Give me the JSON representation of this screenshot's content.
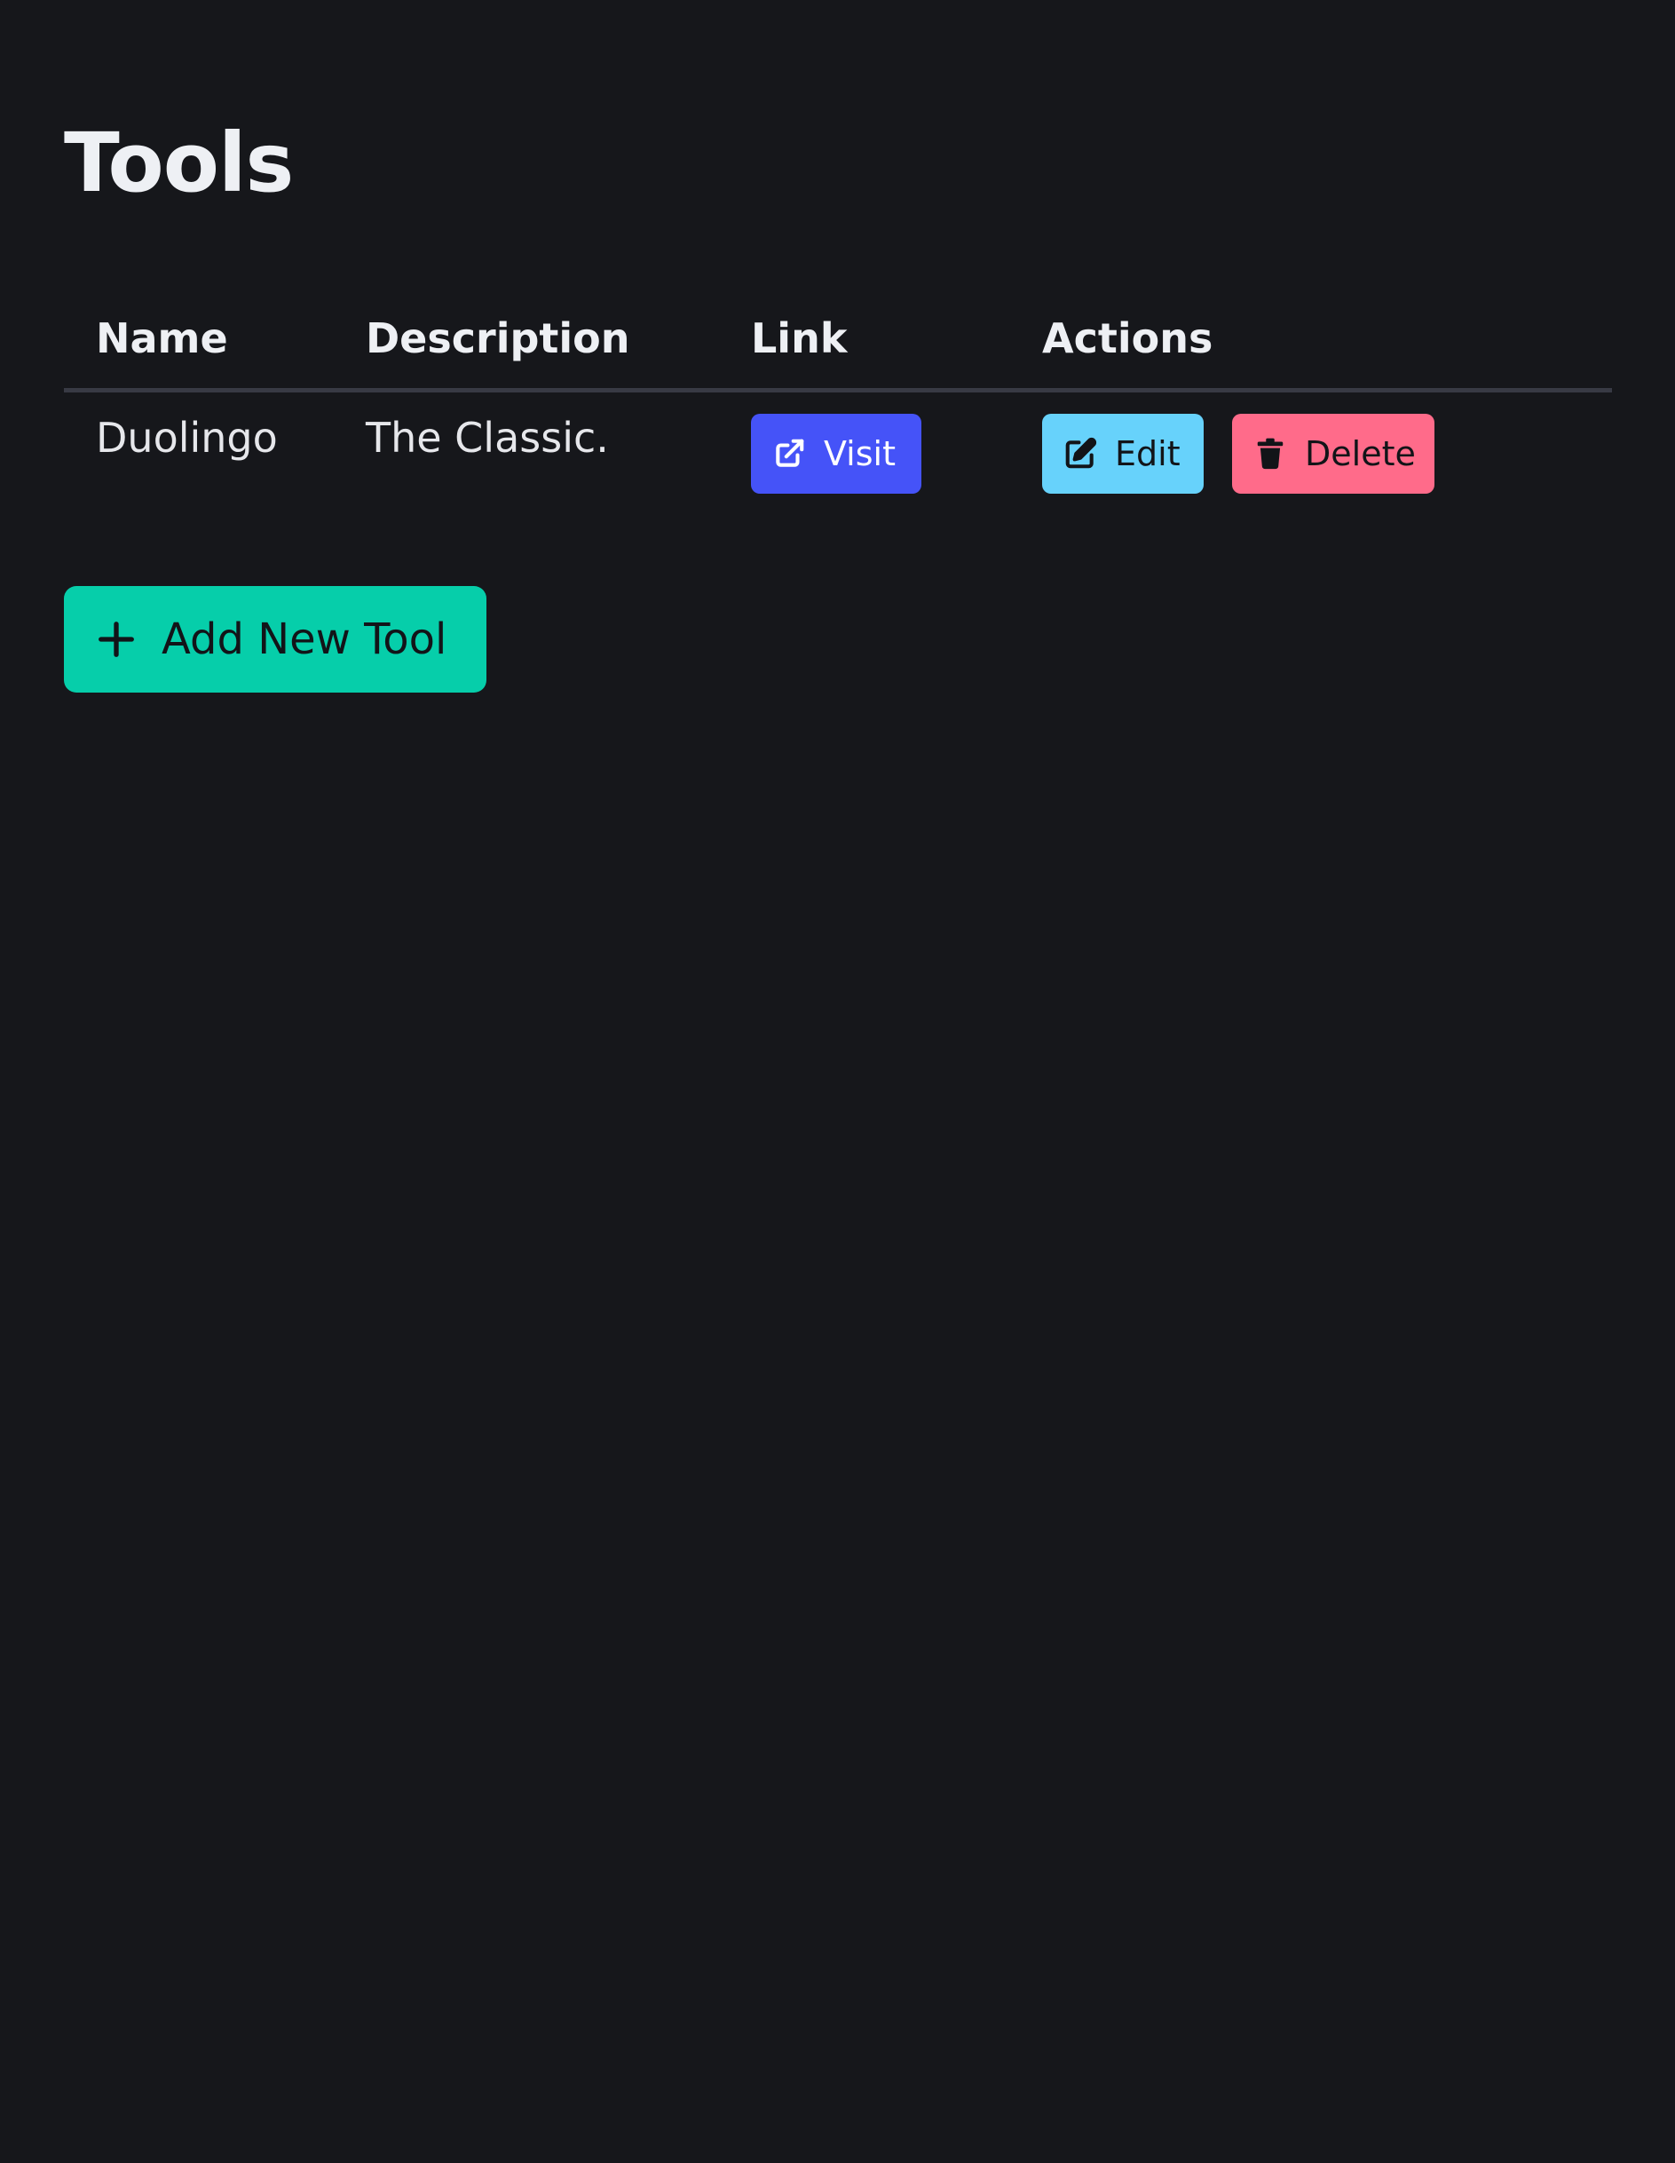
{
  "page": {
    "title": "Tools",
    "background": "#16171b"
  },
  "table": {
    "columns": [
      "Name",
      "Description",
      "Link",
      "Actions"
    ],
    "rows": [
      {
        "name": "Duolingo",
        "description": "The Classic.",
        "link_label": "Visit",
        "edit_label": "Edit",
        "delete_label": "Delete"
      }
    ]
  },
  "actions": {
    "add_label": "Add New Tool"
  },
  "icons": {
    "visit": "external-link-icon",
    "edit": "edit-icon",
    "delete": "trash-icon",
    "add": "plus-icon"
  },
  "colors": {
    "visit": "#4553f8",
    "edit": "#67d2fb",
    "delete": "#ff6b8a",
    "add": "#06ceaa"
  }
}
